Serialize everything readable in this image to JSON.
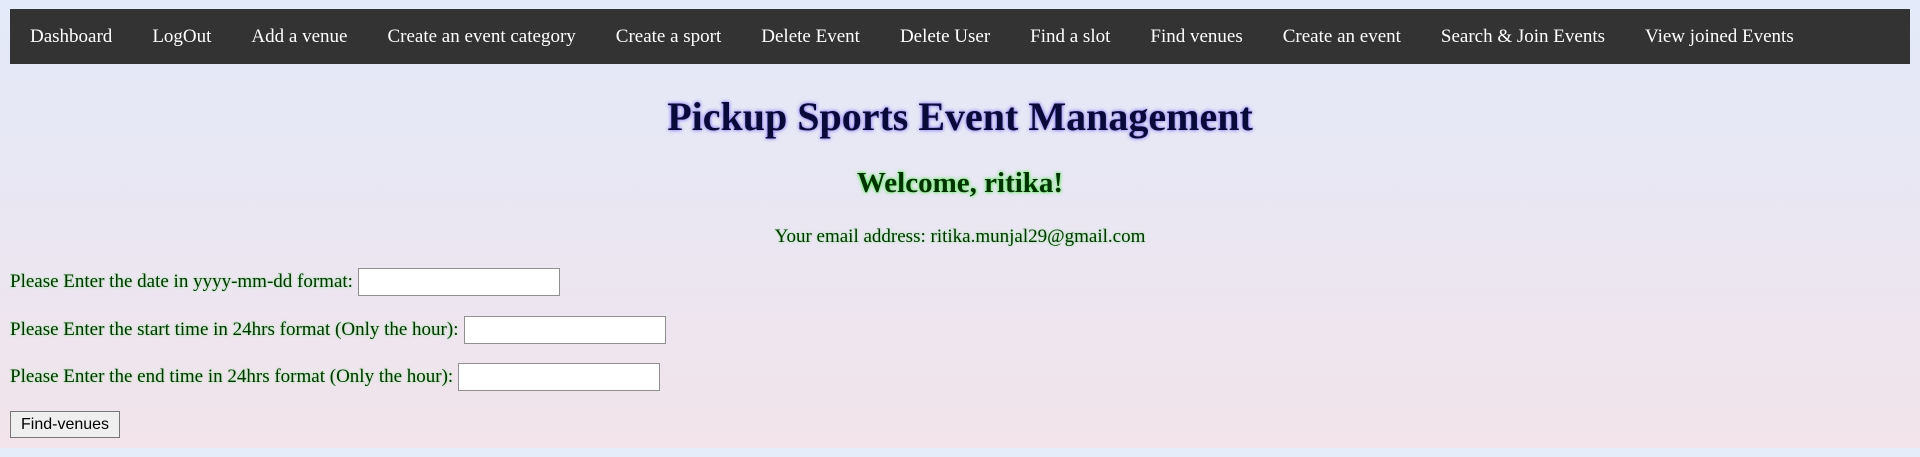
{
  "nav": {
    "items": [
      {
        "label": "Dashboard"
      },
      {
        "label": "LogOut"
      },
      {
        "label": "Add a venue"
      },
      {
        "label": "Create an event category"
      },
      {
        "label": "Create a sport"
      },
      {
        "label": "Delete Event"
      },
      {
        "label": "Delete User"
      },
      {
        "label": "Find a slot"
      },
      {
        "label": "Find venues"
      },
      {
        "label": "Create an event"
      },
      {
        "label": "Search & Join Events"
      },
      {
        "label": "View joined Events"
      }
    ]
  },
  "header": {
    "title": "Pickup Sports Event Management",
    "welcome": "Welcome, ritika!",
    "email": "Your email address: ritika.munjal29@gmail.com"
  },
  "form": {
    "date_label": "Please Enter the date in yyyy-mm-dd format:",
    "date_value": "",
    "start_label": "Please Enter the start time in 24hrs format (Only the hour):",
    "start_value": "",
    "end_label": "Please Enter the end time in 24hrs format (Only the hour):",
    "end_value": "",
    "submit_label": "Find-venues"
  },
  "colors": {
    "navbar_bg": "#333333",
    "nav_text": "#ffffff",
    "title_text": "#0a0a3a",
    "body_text": "#003300"
  }
}
